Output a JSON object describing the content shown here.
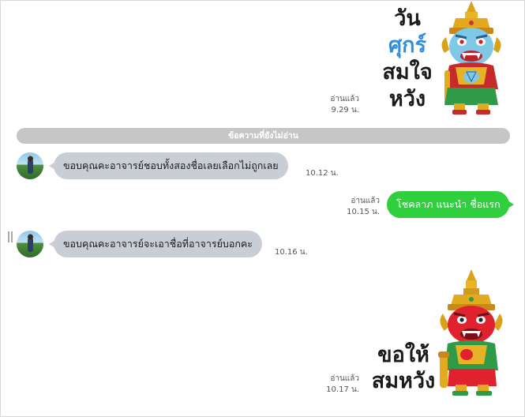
{
  "stickers": {
    "first": {
      "lines": [
        "วัน",
        "ศุกร์",
        "สมใจ",
        "หวัง"
      ],
      "read_label": "อ่านแล้ว",
      "time": "9.29 น.",
      "colors": {
        "text": "#1a1a1a",
        "accent": "#2d8fe0"
      }
    },
    "last": {
      "lines": [
        "ขอให้",
        "สมหวัง"
      ],
      "read_label": "อ่านแล้ว",
      "time": "10.17 น."
    }
  },
  "divider": {
    "label": "ข้อความที่ยังไม่อ่าน"
  },
  "messages": [
    {
      "direction": "in",
      "text": "ขอบคุณคะอาจารย์ชอบทั้งสองชื่อเลยเลือกไม่ถูกเลย",
      "time": "10.12 น."
    },
    {
      "direction": "out",
      "text": "โชคลาภ แนะนำ ชื่อแรก",
      "read_label": "อ่านแล้ว",
      "time": "10.15 น."
    },
    {
      "direction": "in",
      "text": "ขอบคุณคะอาจารย์จะเอาชื่อที่อาจารย์บอกคะ",
      "time": "10.16 น."
    }
  ],
  "colors": {
    "incoming_bubble": "#c9cdd4",
    "outgoing_bubble": "#2fcf3e",
    "divider": "#c6c6c6",
    "background": "#ffffff"
  }
}
